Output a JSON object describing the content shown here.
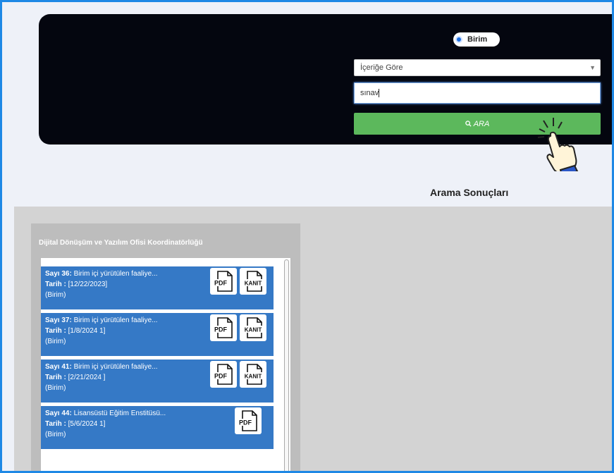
{
  "search": {
    "radio_label": "Birim",
    "select_value": "İçeriğe Göre",
    "query_value": "sınav",
    "button_label": "ARA"
  },
  "results": {
    "title": "Arama Sonuçları",
    "panel_header": "Dijital Dönüşüm ve Yazılım Ofisi Koordinatörlüğü",
    "items": [
      {
        "number_label": "Sayı 36:",
        "subject": "Birim içi yürütülen faaliye...",
        "date_label": "Tarih :",
        "date_value": "[12/22/2023]",
        "type": "(Birim)",
        "pdf_label": "PDF",
        "kanit_label": "KANIT"
      },
      {
        "number_label": "Sayı 37:",
        "subject": "Birim içi yürütülen faaliye...",
        "date_label": "Tarih :",
        "date_value": "[1/8/2024 1]",
        "type": "(Birim)",
        "pdf_label": "PDF",
        "kanit_label": "KANIT"
      },
      {
        "number_label": "Sayı 41:",
        "subject": "Birim içi yürütülen faaliye...",
        "date_label": "Tarih :",
        "date_value": "[2/21/2024 ]",
        "type": "(Birim)",
        "pdf_label": "PDF",
        "kanit_label": "KANIT"
      },
      {
        "number_label": "Sayı 44:",
        "subject": "Lisansüstü Eğitim Enstitüsü...",
        "date_label": "Tarih :",
        "date_value": "[5/6/2024 1]",
        "type": "(Birim)",
        "pdf_label": "PDF"
      }
    ]
  },
  "colors": {
    "frame": "#1e88e5",
    "panel_dark": "#04060f",
    "search_button": "#5cb85c",
    "result_item": "#3579c6"
  },
  "icons": [
    "search-icon",
    "pdf-icon",
    "kanit-icon",
    "hand-pointer-icon",
    "chevron-down-icon"
  ]
}
